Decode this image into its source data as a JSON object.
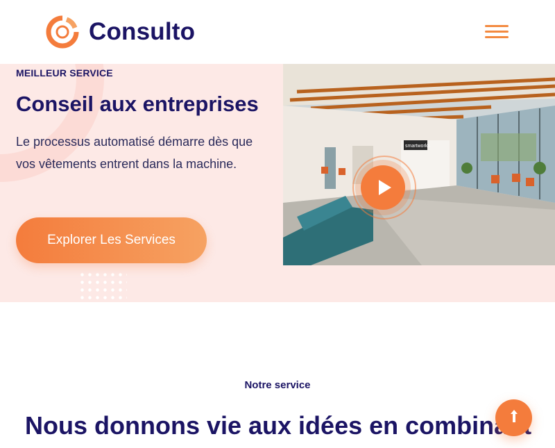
{
  "brand": {
    "name": "Consulto",
    "accent_color": "#f47c3c",
    "navy_color": "#1b1464"
  },
  "header": {
    "logo_icon": "consulto-ring-logo-icon",
    "menu_icon": "hamburger-menu-icon"
  },
  "hero": {
    "eyebrow": "MEILLEUR SERVICE",
    "title": "Conseil aux entreprises",
    "description": "Le processus automatisé démarre dès que vos vêtements entrent dans la machine.",
    "cta_label": "Explorer Les Services",
    "play_icon": "play-icon",
    "image_sign_text": "smartworks",
    "background_color": "#fde9e6"
  },
  "services": {
    "kicker": "Notre service",
    "title": "Nous donnons vie aux idées en combinant"
  },
  "floating": {
    "scroll_top_icon": "arrow-up-icon"
  }
}
